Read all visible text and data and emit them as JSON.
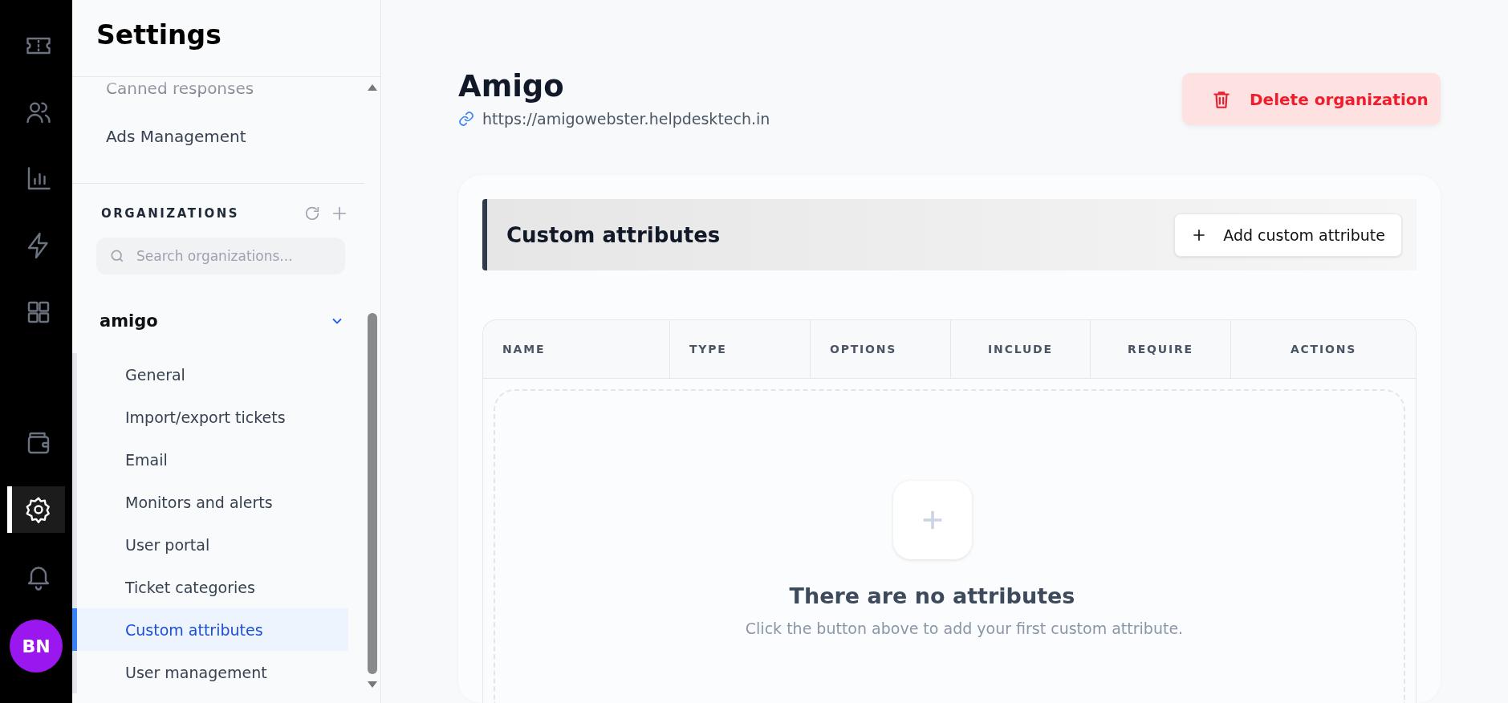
{
  "rail": {
    "items": [
      {
        "kind": "ticket",
        "selected": false
      },
      {
        "kind": "users",
        "selected": false
      },
      {
        "kind": "chart",
        "selected": false
      },
      {
        "kind": "bolt",
        "selected": false
      },
      {
        "kind": "grid",
        "selected": false
      },
      {
        "kind": "wallet",
        "selected": false
      },
      {
        "kind": "gear",
        "selected": true
      },
      {
        "kind": "bell",
        "selected": false
      }
    ],
    "avatar": {
      "initials": "BN"
    }
  },
  "settings_panel": {
    "title": "Settings",
    "items": [
      {
        "label": "Canned responses"
      },
      {
        "label": "Ads Management"
      }
    ],
    "organizations": {
      "heading": "ORGANIZATIONS",
      "search": {
        "placeholder": "Search organizations..."
      },
      "orgs": [
        {
          "name": "amigo",
          "expanded": true,
          "children": [
            {
              "label": "General",
              "selected": false
            },
            {
              "label": "Import/export tickets",
              "selected": false
            },
            {
              "label": "Email",
              "selected": false
            },
            {
              "label": "Monitors and alerts",
              "selected": false
            },
            {
              "label": "User portal",
              "selected": false
            },
            {
              "label": "Ticket categories",
              "selected": false
            },
            {
              "label": "Custom attributes",
              "selected": true
            },
            {
              "label": "User management",
              "selected": false
            }
          ]
        }
      ]
    }
  },
  "main": {
    "title": "Amigo",
    "url": "https://amigowebster.helpdesktech.in",
    "delete_button": "Delete organization",
    "section": {
      "title": "Custom attributes",
      "add_button": "Add custom attribute"
    },
    "table": {
      "columns": [
        {
          "label": "NAME"
        },
        {
          "label": "TYPE"
        },
        {
          "label": "OPTIONS"
        },
        {
          "label": "INCLUDE"
        },
        {
          "label": "REQUIRE"
        },
        {
          "label": "ACTIONS"
        }
      ]
    },
    "empty_state": {
      "title": "There are no attributes",
      "text": "Click the button above to add your first custom attribute."
    }
  }
}
